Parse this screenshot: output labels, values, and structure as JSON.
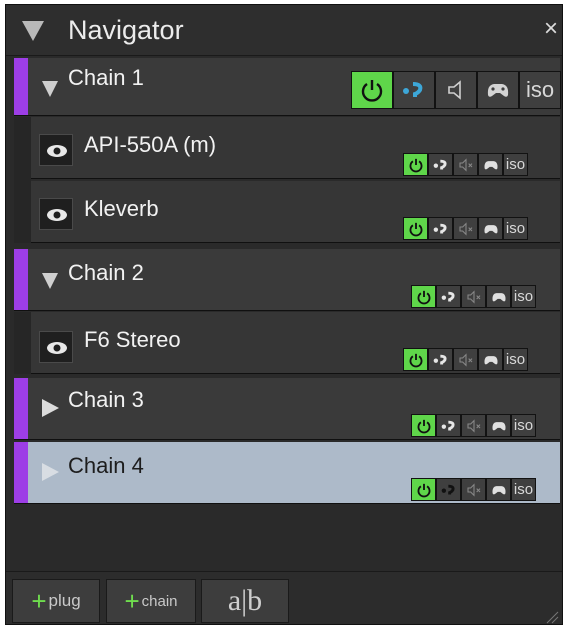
{
  "panel": {
    "title": "Navigator",
    "close_glyph": "×"
  },
  "chains": [
    {
      "label": "Chain 1",
      "expanded": true,
      "selected": false
    },
    {
      "label": "Chain 2",
      "expanded": true,
      "selected": false
    },
    {
      "label": "Chain 3",
      "expanded": false,
      "selected": false
    },
    {
      "label": "Chain 4",
      "expanded": false,
      "selected": true
    }
  ],
  "plugins": [
    {
      "label": "API-550A (m)",
      "chain": "Chain 1"
    },
    {
      "label": "Kleverb",
      "chain": "Chain 1"
    },
    {
      "label": "F6 Stereo",
      "chain": "Chain 2"
    }
  ],
  "buttons": {
    "iso": "iso"
  },
  "toolbar": {
    "plus": "+",
    "plug": "plug",
    "chain": "chain",
    "ab": "a|b"
  },
  "colors": {
    "chain_bar": "#9d3ee6",
    "power_on": "#5fd64a",
    "selected_row": "#adbac9",
    "sidechain_blue": "#3da7d8"
  }
}
